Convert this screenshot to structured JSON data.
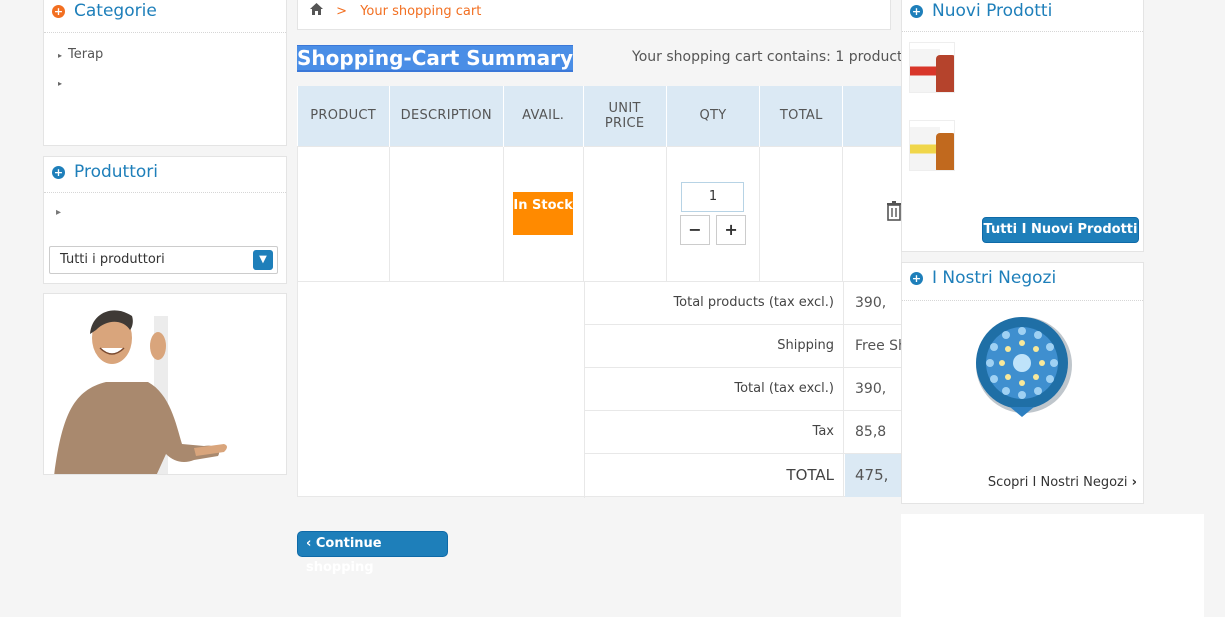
{
  "left": {
    "categorie": {
      "title": "Categorie",
      "items": [
        "Terap",
        ""
      ]
    },
    "produttori": {
      "title": "Produttori",
      "select_value": "Tutti i produttori"
    }
  },
  "breadcrumb": {
    "separator": ">",
    "current": "Your shopping cart"
  },
  "cart": {
    "title": "Shopping-Cart Summary",
    "count_text": "Your shopping cart contains: 1 product",
    "headers": [
      "PRODUCT",
      "DESCRIPTION",
      "AVAIL.",
      "UNIT PRICE",
      "QTY",
      "TOTAL",
      ""
    ],
    "item": {
      "availability": "In Stock",
      "qty": "1",
      "minus": "−",
      "plus": "+"
    },
    "totals": [
      {
        "label": "Total products (tax excl.)",
        "value": "390,"
      },
      {
        "label": "Shipping",
        "value": "Free Sh"
      },
      {
        "label": "Total (tax excl.)",
        "value": "390,"
      },
      {
        "label": "Tax",
        "value": "85,8"
      },
      {
        "label": "TOTAL",
        "value": "475,"
      }
    ],
    "continue_label": "Continue shopping"
  },
  "right": {
    "nuovi": {
      "title": "Nuovi Prodotti",
      "button": "Tutti I Nuovi Prodotti"
    },
    "negozi": {
      "title": "I Nostri Negozi",
      "link": "Scopri I Nostri Negozi"
    }
  },
  "colors": {
    "accent": "#1e7fba",
    "orange": "#f26f21",
    "stock": "#ff8a00",
    "header_bg": "#dbe9f4"
  }
}
